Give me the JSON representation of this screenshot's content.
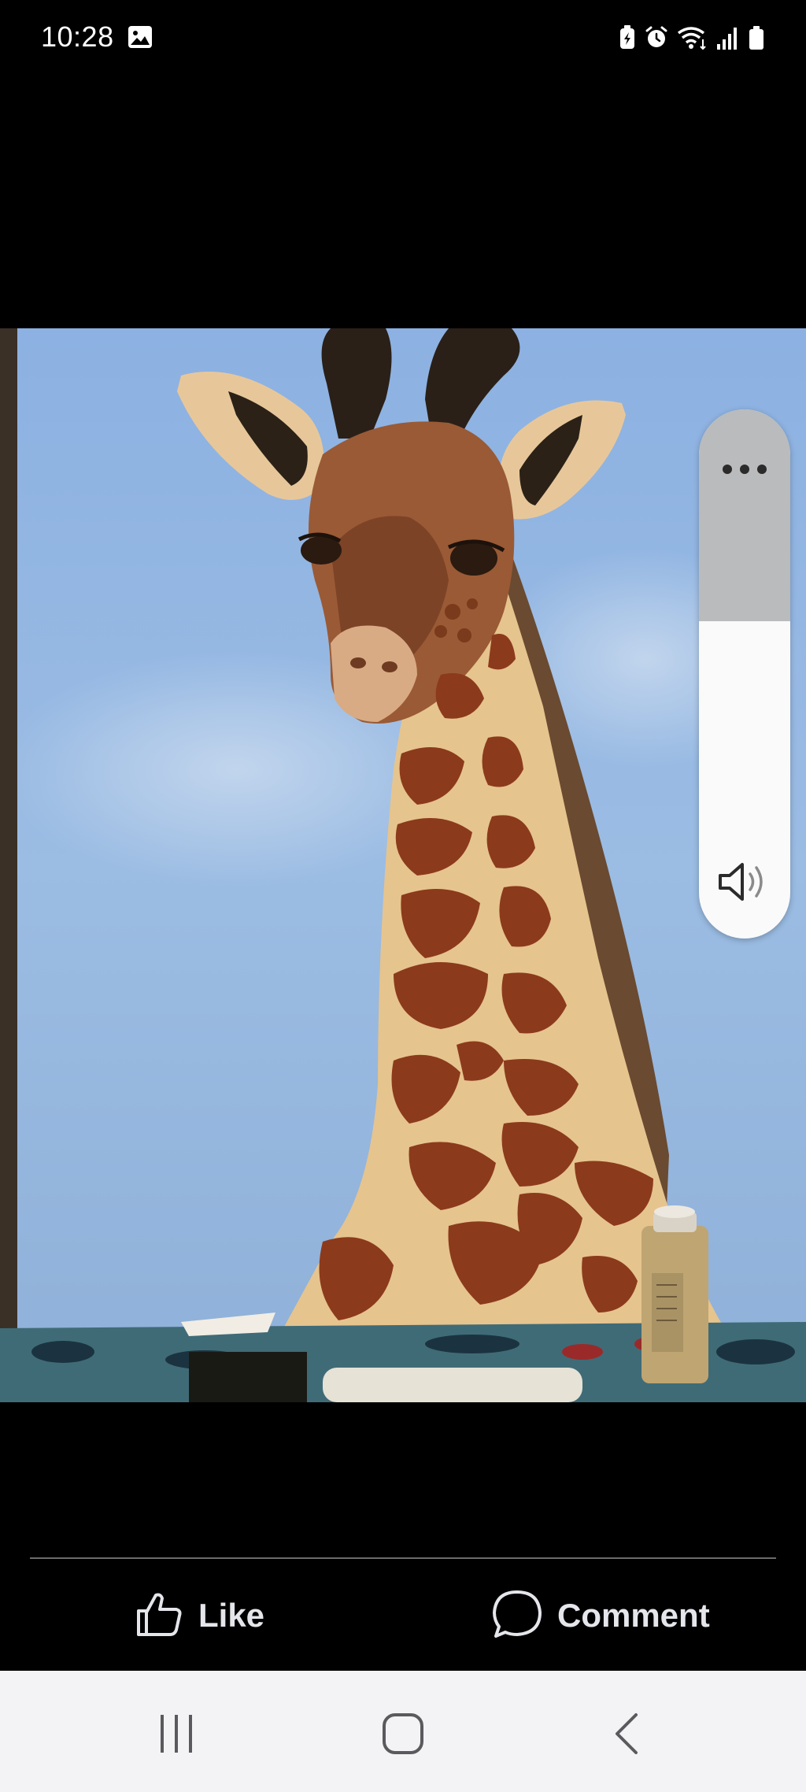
{
  "status_bar": {
    "time": "10:28",
    "left_icons": [
      "gallery-icon"
    ],
    "right_icons": [
      "battery-saver-icon",
      "alarm-icon",
      "wifi-icon",
      "signal-icon",
      "battery-icon"
    ]
  },
  "photo": {
    "subject": "giraffe-painting",
    "colors": {
      "sky": "#8fb2df",
      "giraffe_light": "#e8c48c",
      "giraffe_spot": "#8c3a1c",
      "horn": "#2a2017"
    }
  },
  "volume_panel": {
    "more_icon": "more-dots-icon",
    "speaker_icon": "speaker-icon",
    "level": 0.6
  },
  "actions": {
    "like_label": "Like",
    "like_icon": "thumbs-up-icon",
    "comment_label": "Comment",
    "comment_icon": "comment-bubble-icon"
  },
  "nav_bar": {
    "recent_icon": "recent-apps-icon",
    "home_icon": "home-icon",
    "back_icon": "back-icon"
  }
}
